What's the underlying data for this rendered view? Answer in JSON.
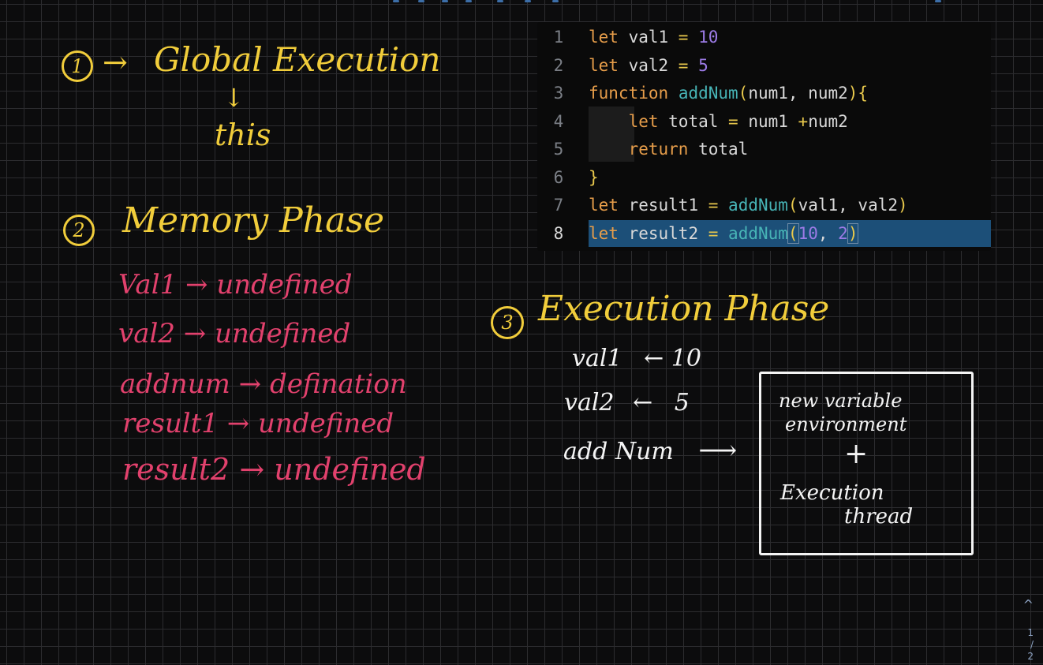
{
  "whiteboard": {
    "step1": {
      "marker": "1",
      "arrow": "→",
      "title": "Global Execution",
      "down_arrow": "↓",
      "sub": "this"
    },
    "step2": {
      "marker": "2",
      "title": "Memory Phase",
      "items": [
        {
          "name": "Val1",
          "arrow": "→",
          "value": "undefined"
        },
        {
          "name": "val2",
          "arrow": "→",
          "value": "undefined"
        },
        {
          "name": "addnum",
          "arrow": "→",
          "value": "defination"
        },
        {
          "name": "result1",
          "arrow": "→",
          "value": "undefined"
        },
        {
          "name": "result2",
          "arrow": "→",
          "value": "undefined"
        }
      ]
    },
    "step3": {
      "marker": "3",
      "title": "Execution Phase",
      "rows": [
        {
          "name": "val1",
          "arrow": "←",
          "value": "10"
        },
        {
          "name": "val2",
          "arrow": "←",
          "value": "5"
        },
        {
          "name": "add Num",
          "arrow": "⟶"
        }
      ],
      "box": {
        "line1": "new variable",
        "line2": "environment",
        "plus": "+",
        "line3": "Execution",
        "line4": "thread"
      }
    }
  },
  "editor": {
    "lines": [
      {
        "num": "1",
        "tokens": [
          [
            "kw",
            "let"
          ],
          [
            "id",
            " val1 "
          ],
          [
            "op",
            "="
          ],
          [
            "id",
            " "
          ],
          [
            "num",
            "10"
          ]
        ]
      },
      {
        "num": "2",
        "tokens": [
          [
            "kw",
            "let"
          ],
          [
            "id",
            " val2 "
          ],
          [
            "op",
            "="
          ],
          [
            "id",
            " "
          ],
          [
            "num",
            "5"
          ]
        ]
      },
      {
        "num": "3",
        "tokens": [
          [
            "kw",
            "function"
          ],
          [
            "id",
            " "
          ],
          [
            "fn",
            "addNum"
          ],
          [
            "br",
            "("
          ],
          [
            "id",
            "num1, num2"
          ],
          [
            "br",
            ")"
          ],
          [
            "br",
            "{"
          ]
        ]
      },
      {
        "num": "4",
        "tokens": [
          [
            "id",
            "    "
          ],
          [
            "kw",
            "let"
          ],
          [
            "id",
            " total "
          ],
          [
            "op",
            "="
          ],
          [
            "id",
            " num1 "
          ],
          [
            "op",
            "+"
          ],
          [
            "id",
            "num2"
          ]
        ]
      },
      {
        "num": "5",
        "tokens": [
          [
            "id",
            "    "
          ],
          [
            "kw",
            "return"
          ],
          [
            "id",
            " total"
          ]
        ]
      },
      {
        "num": "6",
        "tokens": [
          [
            "br",
            "}"
          ]
        ]
      },
      {
        "num": "7",
        "tokens": [
          [
            "kw",
            "let"
          ],
          [
            "id",
            " result1 "
          ],
          [
            "op",
            "="
          ],
          [
            "id",
            " "
          ],
          [
            "fn",
            "addNum"
          ],
          [
            "br",
            "("
          ],
          [
            "id",
            "val1, val2"
          ],
          [
            "br",
            ")"
          ]
        ]
      },
      {
        "num": "8",
        "active": true,
        "tokens": [
          [
            "kw",
            "let"
          ],
          [
            "id",
            " result2 "
          ],
          [
            "op",
            "="
          ],
          [
            "id",
            " "
          ],
          [
            "fn",
            "addNum"
          ],
          [
            "br-hl",
            "("
          ],
          [
            "num",
            "10"
          ],
          [
            "id",
            ", "
          ],
          [
            "num",
            "2"
          ],
          [
            "br-hl",
            ")"
          ]
        ]
      }
    ]
  },
  "scroll": {
    "up": "^",
    "page": "1",
    "sep": "/",
    "total": "2"
  },
  "colors": {
    "background": "#0c0c0d",
    "grid": "#2c2c2f",
    "yellow_marker": "#f1cd3b",
    "pink_marker": "#e2416d",
    "white_marker": "#f4f4f4",
    "highlight": "#1c4f78"
  }
}
